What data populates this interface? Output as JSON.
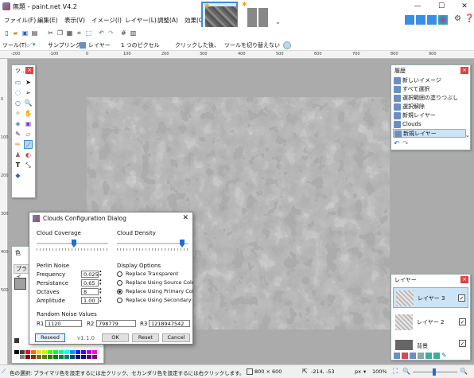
{
  "window": {
    "title": "無題 - paint.net V4.2",
    "controls": {
      "minimize": "—",
      "maximize": "☐",
      "close": "✕"
    }
  },
  "menu": [
    {
      "label": "ファイル(F)"
    },
    {
      "label": "編集(E)"
    },
    {
      "label": "表示(V)"
    },
    {
      "label": "イメージ(I)"
    },
    {
      "label": "レイヤー(L)"
    },
    {
      "label": "調整(A)"
    },
    {
      "label": "効果(C)"
    }
  ],
  "toolbar2": {
    "tool_label": "ツール(T):",
    "sampling_label": "サンプリング:",
    "sampling_value": "レイヤー",
    "pixel_value": "1 つのピクセル",
    "click_label": "クリックした後、",
    "switch_value": "ツールを切り替えない"
  },
  "ruler_top": [
    "-200",
    "-100",
    "0",
    "100",
    "200",
    "300",
    "400",
    "500",
    "600",
    "700",
    "800",
    "900"
  ],
  "ruler_left": [
    "0",
    "100",
    "200",
    "300",
    "400",
    "500"
  ],
  "tools_panel": {
    "title": "ツ..."
  },
  "history_panel": {
    "title": "履歴",
    "items": [
      "新しいイメージ",
      "すべて選択",
      "選択範囲の塗りつぶし",
      "選択解除",
      "新規レイヤー",
      "Clouds",
      "新規レイヤー"
    ]
  },
  "layers_panel": {
    "title": "レイヤー",
    "layers": [
      {
        "name": "レイヤー 3",
        "checked": true
      },
      {
        "name": "レイヤー 2",
        "checked": true
      },
      {
        "name": "背景",
        "checked": true
      }
    ]
  },
  "colors_panel": {
    "title": "色",
    "tab": "プライ"
  },
  "dialog": {
    "title": "Clouds Configuration Dialog",
    "cloud_coverage_label": "Cloud Coverage",
    "cloud_density_label": "Cloud Density",
    "perlin_label": "Perlin Noise",
    "frequency_label": "Frequency",
    "frequency_value": "0.025",
    "persistance_label": "Persistance",
    "persistance_value": "0.65",
    "octaves_label": "Octaves",
    "octaves_value": "8",
    "amplitude_label": "Amplitude",
    "amplitude_value": "1.00",
    "display_label": "Display Options",
    "options": [
      {
        "label": "Replace Transparent",
        "selected": false
      },
      {
        "label": "Replace Using Source Colo",
        "selected": false
      },
      {
        "label": "Replace Using Primary Colo",
        "selected": true
      },
      {
        "label": "Replace Using Secondary C",
        "selected": false
      }
    ],
    "random_label": "Random Noise Values",
    "r1_label": "R1",
    "r1_value": "1120",
    "r2_label": "R2",
    "r2_value": "798779",
    "r3_label": "R3",
    "r3_value": "1218947542",
    "reseed_label": "Reseed",
    "version": "v1.1.0",
    "ok_label": "OK",
    "reset_label": "Reset",
    "cancel_label": "Cancel"
  },
  "status": {
    "hint": "色の選択: プライマリ色を設定するには左クリック、セカンダリ色を設定するには右クリックします。",
    "size": "800 × 600",
    "coords": "-214, -53",
    "unit": "px",
    "zoom": "100%"
  }
}
